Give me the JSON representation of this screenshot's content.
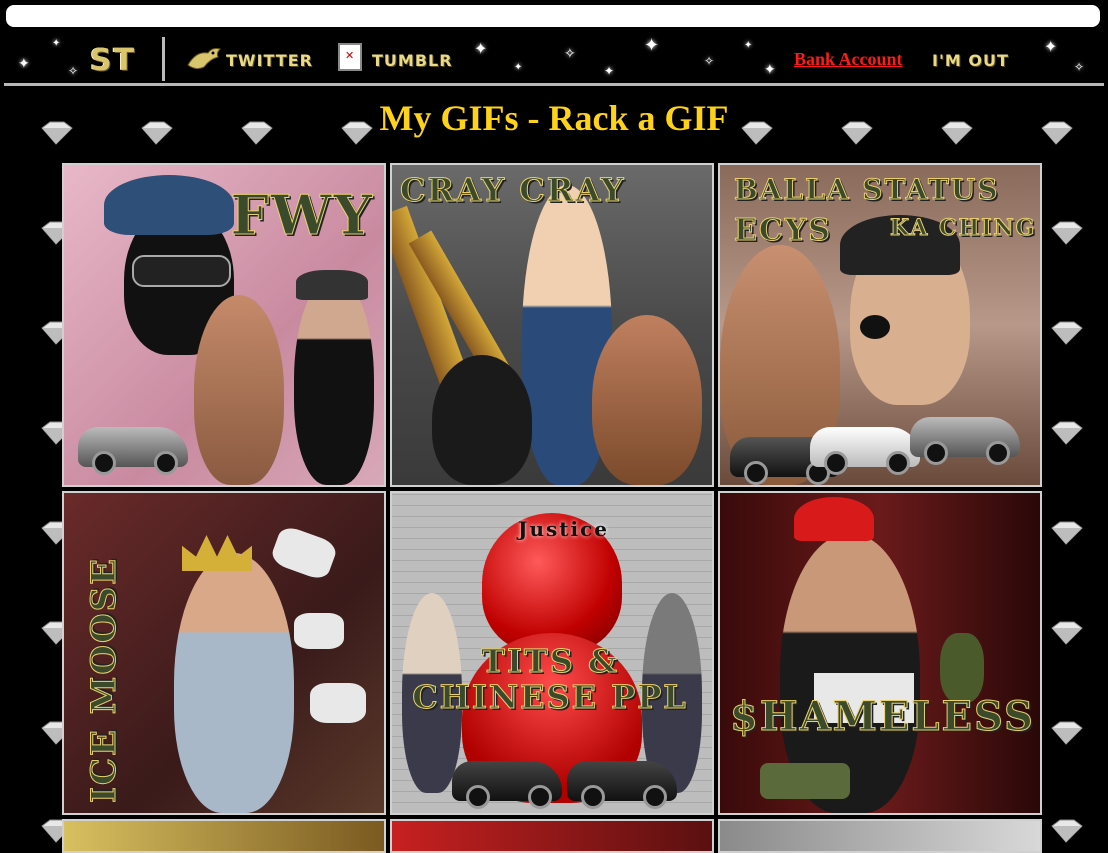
{
  "nav": {
    "logo": "ST",
    "twitter_label": "TWITTER",
    "tumblr_label": "TUMBLR",
    "bank_label": "Bank Account",
    "logout_label": "I'M OUT"
  },
  "page_title": "My GIFs - Rack a GIF",
  "colors": {
    "title": "#ffd21a",
    "bank_link": "#ff1a1a",
    "background": "#000000"
  },
  "gifs": [
    {
      "title": "FWY",
      "icon": "gif-thumbnail"
    },
    {
      "title": "CRAY CRAY",
      "icon": "gif-thumbnail"
    },
    {
      "title": "BALLA STATUS",
      "subtitle": "ECYS",
      "subtitle2": "KA CHING",
      "icon": "gif-thumbnail"
    },
    {
      "title": "ICE MOOSE",
      "icon": "gif-thumbnail"
    },
    {
      "title": "TITS & CHINESE PPL",
      "badge": "Justice",
      "icon": "gif-thumbnail"
    },
    {
      "title": "$HAMELESS",
      "icon": "gif-thumbnail"
    }
  ]
}
